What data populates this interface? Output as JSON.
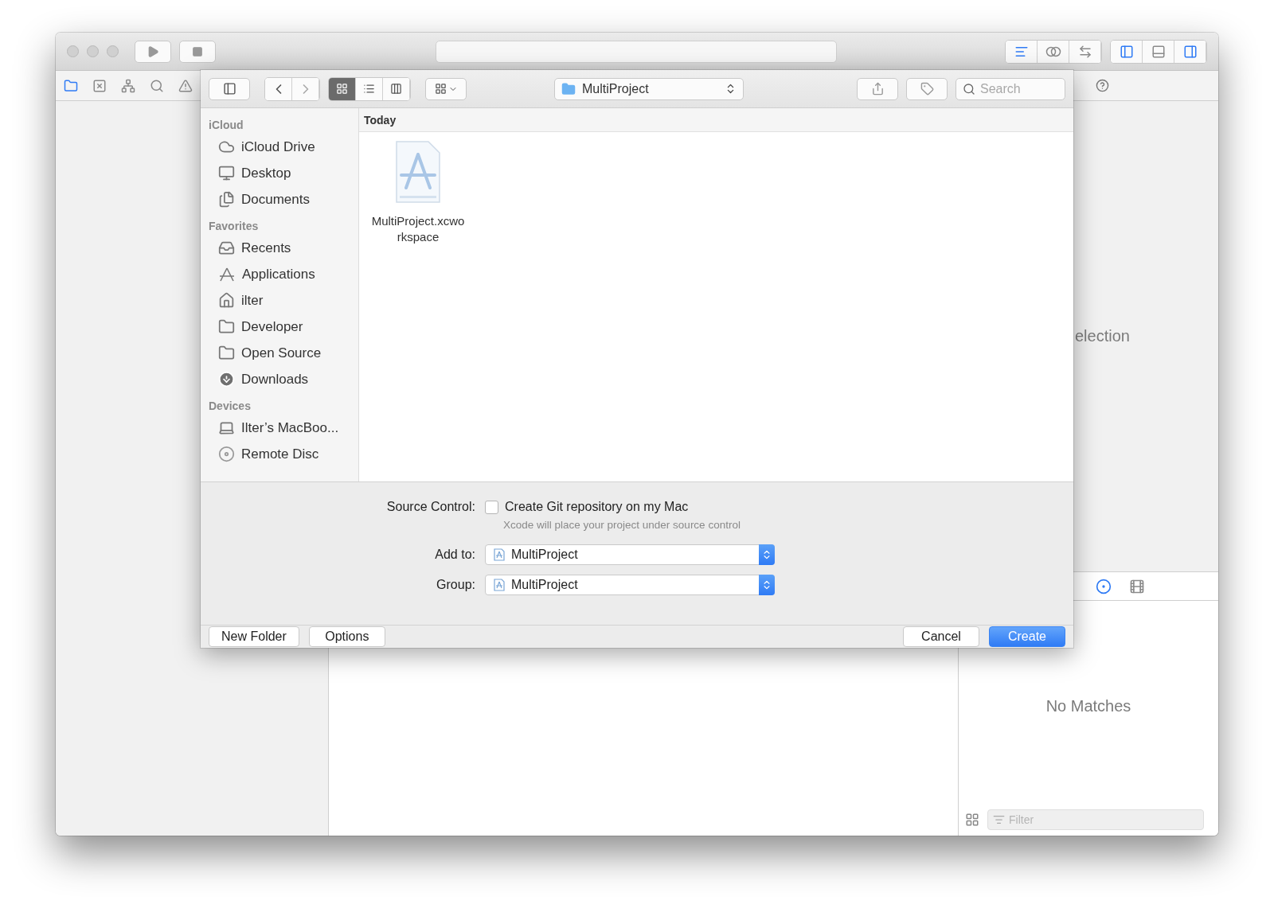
{
  "xcode": {
    "navigator_tabs": [
      {
        "selected": true
      },
      {
        "selected": false
      },
      {
        "selected": false
      },
      {
        "selected": false
      },
      {
        "selected": false
      }
    ],
    "editor_modes": [
      {
        "selected": true
      },
      {
        "selected": false
      },
      {
        "selected": false
      }
    ],
    "panels": [
      {
        "on": true
      },
      {
        "on": false
      },
      {
        "on": true
      }
    ],
    "inspector": {
      "message": "election",
      "library_tabs": [
        {
          "selected": true
        },
        {
          "selected": false
        }
      ],
      "library_message": "No Matches",
      "filter": {
        "placeholder": "Filter"
      }
    }
  },
  "dialog": {
    "view_modes": [
      {
        "selected": true
      },
      {
        "selected": false
      },
      {
        "selected": false
      }
    ],
    "location": "MultiProject",
    "search": {
      "placeholder": "Search"
    },
    "sidebar": [
      {
        "heading": "iCloud",
        "items": [
          {
            "label": "iCloud Drive",
            "kind": "cloud"
          },
          {
            "label": "Desktop",
            "kind": "desktop"
          },
          {
            "label": "Documents",
            "kind": "documents"
          }
        ]
      },
      {
        "heading": "Favorites",
        "items": [
          {
            "label": "Recents",
            "kind": "recents"
          },
          {
            "label": "Applications",
            "kind": "applications"
          },
          {
            "label": "ilter",
            "kind": "home"
          },
          {
            "label": "Developer",
            "kind": "folder"
          },
          {
            "label": "Open Source",
            "kind": "folder"
          },
          {
            "label": "Downloads",
            "kind": "downloads"
          }
        ]
      },
      {
        "heading": "Devices",
        "items": [
          {
            "label": "Ilter’s MacBoo...",
            "kind": "laptop"
          },
          {
            "label": "Remote Disc",
            "kind": "disc"
          }
        ]
      }
    ],
    "group_header": "Today",
    "files": [
      {
        "name_lines": [
          "MultiProject.xcwo",
          "rkspace"
        ]
      }
    ],
    "source_control": {
      "label": "Source Control:",
      "option": "Create Git repository on my Mac",
      "checked": false,
      "hint": "Xcode will place your project under source control"
    },
    "popups": [
      {
        "label": "Add to:",
        "value": "MultiProject"
      },
      {
        "label": "Group:",
        "value": "MultiProject"
      }
    ],
    "left_buttons": [
      "New Folder",
      "Options"
    ],
    "right_buttons": [
      {
        "label": "Cancel",
        "kind": "secondary"
      },
      {
        "label": "Create",
        "kind": "primary"
      }
    ]
  }
}
